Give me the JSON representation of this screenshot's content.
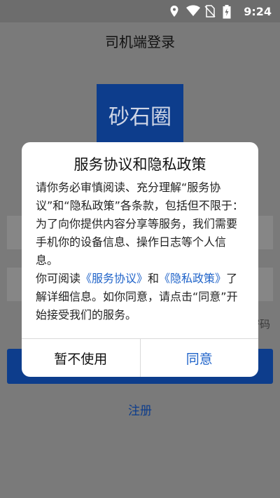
{
  "status_bar": {
    "time": "9:24"
  },
  "app": {
    "title": "司机端登录",
    "logo_text": "砂石圈",
    "forgot_password": "忘记密码",
    "register": "注册"
  },
  "dialog": {
    "title": "服务协议和隐私政策",
    "paragraph1": "请你务必审慎阅读、充分理解“服务协议”和“隐私政策”各条款，包括但不限于：为了向你提供内容分享等服务，我们需要手机你的设备信息、操作日志等个人信息。",
    "p2_prefix": "你可阅读",
    "service_link": "《服务协议》",
    "p2_and": "和",
    "privacy_link": "《隐私政策》",
    "p2_suffix": "了解详细信息。如你同意，请点击“同意”开始接受我们的服务。",
    "decline_label": "暂不使用",
    "agree_label": "同意"
  },
  "colors": {
    "brand": "#0d3d8c",
    "link": "#1f63c9",
    "overlay": "#7a7a7a"
  }
}
